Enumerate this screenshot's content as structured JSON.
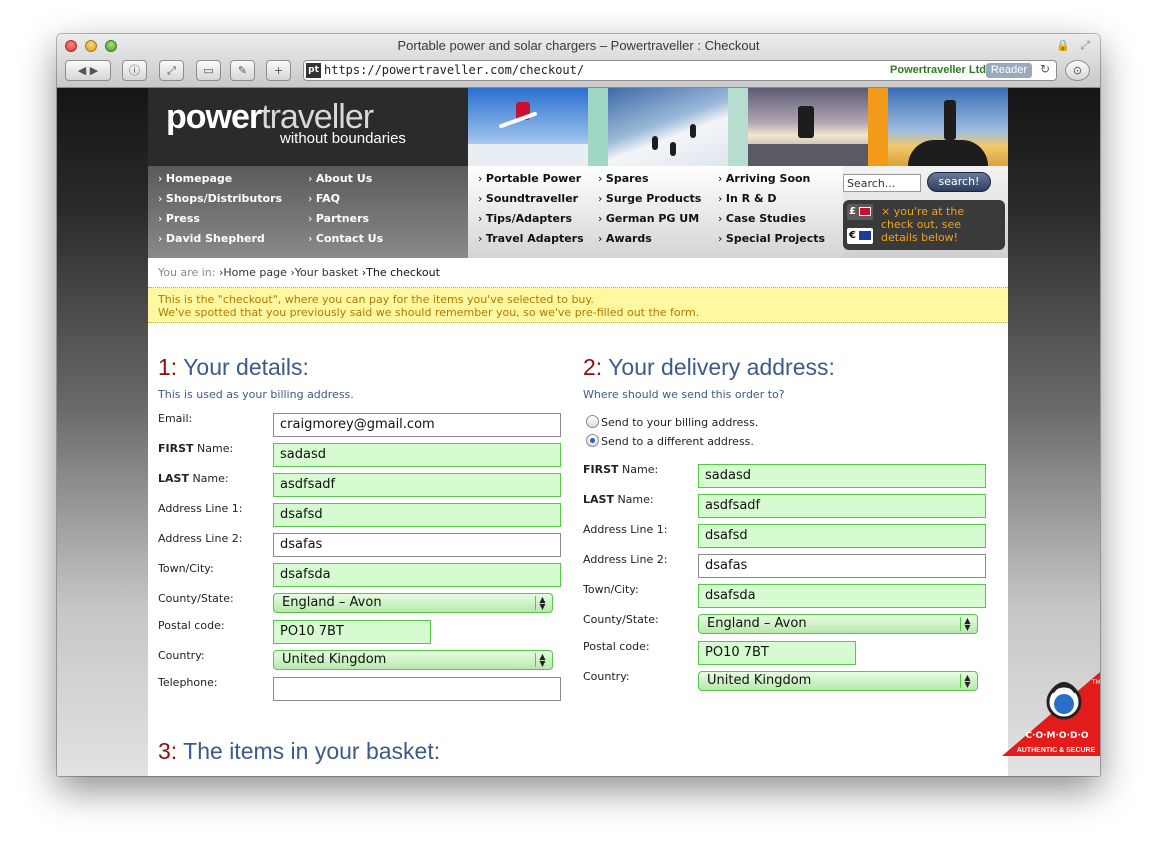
{
  "window": {
    "title": "Portable power and solar chargers – Powertraveller : Checkout",
    "url": "https://powertraveller.com/checkout/",
    "favicon_text": "pt",
    "cert_name": "Powertraveller Ltd",
    "reader_label": "Reader"
  },
  "brand": {
    "logo_bold": "power",
    "logo_light": "traveller",
    "tagline": "without boundaries"
  },
  "nav": {
    "left_col1": [
      "Homepage",
      "Shops/Distributors",
      "Press",
      "David Shepherd"
    ],
    "left_col2": [
      "About Us",
      "FAQ",
      "Partners",
      "Contact Us"
    ],
    "mid_col1": [
      "Portable Power",
      "Soundtraveller",
      "Tips/Adapters",
      "Travel Adapters"
    ],
    "mid_col2": [
      "Spares",
      "Surge Products",
      "German PG UM",
      "Awards"
    ],
    "mid_col3": [
      "Arriving Soon",
      "In R & D",
      "Case Studies",
      "Special Projects"
    ],
    "search_placeholder": "Search...",
    "search_button": "search!",
    "currency_gbp": "£",
    "currency_eur": "€",
    "currency_note": "× you're at the check out, see details below!"
  },
  "breadcrumb": {
    "prefix": "You are in:",
    "items": [
      "›Home page",
      "›Your basket",
      "›The checkout"
    ]
  },
  "notice": {
    "line1": "This is the \"checkout\", where you can pay for the items you've selected to buy.",
    "line2": "We've spotted that you previously said we should remember you, so we've pre-filled out the form."
  },
  "details": {
    "num": "1:",
    "title": "Your details:",
    "subtitle": "This is used as your billing address.",
    "email_label": "Email:",
    "email": "craigmorey@gmail.com",
    "first_bold": "FIRST",
    "first_rest": " Name:",
    "first": "sadasd",
    "last_bold": "LAST",
    "last_rest": " Name:",
    "last": "asdfsadf",
    "addr1_label": "Address Line 1:",
    "addr1": "dsafsd",
    "addr2_label": "Address Line 2:",
    "addr2": "dsafas",
    "town_label": "Town/City:",
    "town": "dsafsda",
    "county_label": "County/State:",
    "county": "England – Avon",
    "postal_label": "Postal code:",
    "postal": "PO10 7BT",
    "country_label": "Country:",
    "country": "United Kingdom",
    "phone_label": "Telephone:",
    "phone": ""
  },
  "delivery": {
    "num": "2:",
    "title": "Your delivery address:",
    "subtitle": "Where should we send this order to?",
    "option_billing": "Send to your billing address.",
    "option_different": "Send to a different address.",
    "selected_option": "different",
    "first_bold": "FIRST",
    "first_rest": " Name:",
    "first": "sadasd",
    "last_bold": "LAST",
    "last_rest": " Name:",
    "last": "asdfsadf",
    "addr1_label": "Address Line 1:",
    "addr1": "dsafsd",
    "addr2_label": "Address Line 2:",
    "addr2": "dsafas",
    "town_label": "Town/City:",
    "town": "dsafsda",
    "county_label": "County/State:",
    "county": "England – Avon",
    "postal_label": "Postal code:",
    "postal": "PO10 7BT",
    "country_label": "Country:",
    "country": "United Kingdom"
  },
  "basket": {
    "num": "3:",
    "title": "The items in your basket:"
  },
  "badge": {
    "name": "C·O·M·O·D·O",
    "tagline": "AUTHENTIC & SECURE",
    "tm": "TM"
  },
  "colors": {
    "heading_blue": "#3d5a8a",
    "number_red": "#8a1010",
    "valid_green": "#d6fbd0",
    "notice_yellow": "#fff8a0"
  }
}
